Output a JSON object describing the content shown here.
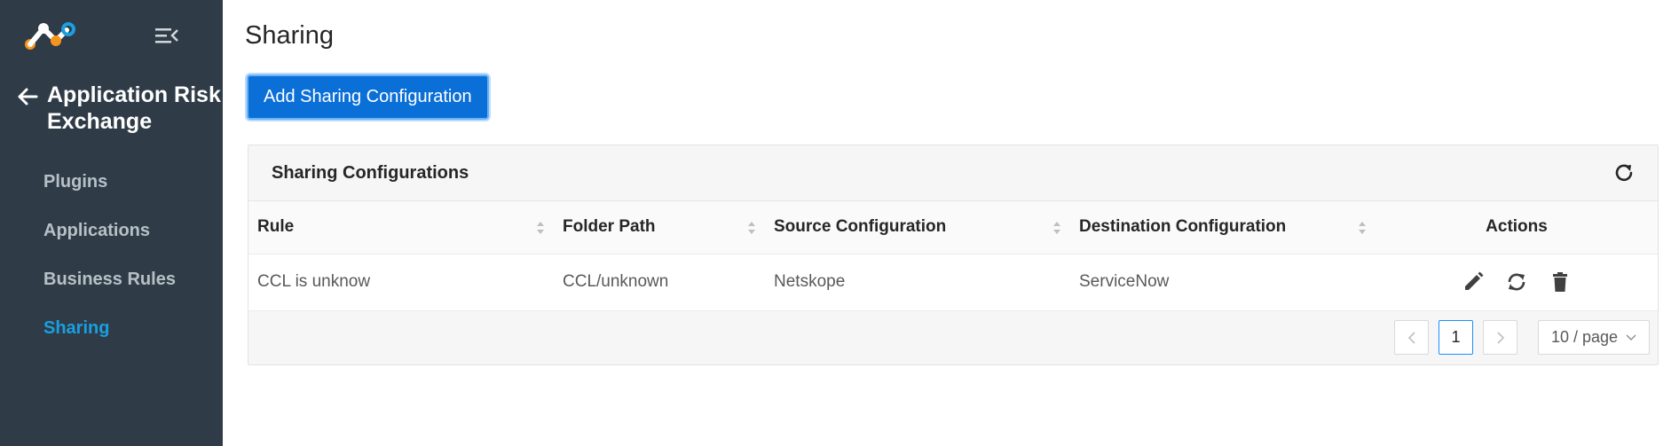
{
  "sidebar": {
    "section_title": "Application Risk Exchange",
    "items": [
      {
        "label": "Plugins",
        "active": false
      },
      {
        "label": "Applications",
        "active": false
      },
      {
        "label": "Business Rules",
        "active": false
      },
      {
        "label": "Sharing",
        "active": true
      }
    ]
  },
  "main": {
    "title": "Sharing",
    "add_button_label": "Add Sharing Configuration",
    "card": {
      "title": "Sharing Configurations",
      "columns": [
        "Rule",
        "Folder Path",
        "Source Configuration",
        "Destination Configuration",
        "Actions"
      ],
      "rows": [
        {
          "rule": "CCL is unknow",
          "folder_path": "CCL/unknown",
          "source": "Netskope",
          "destination": "ServiceNow"
        }
      ]
    },
    "pagination": {
      "current_page": "1",
      "page_size_label": "10 / page"
    }
  },
  "colors": {
    "sidebar_bg": "#2f3c47",
    "active_nav": "#1a9fe0",
    "primary_button": "#0b6fd8",
    "logo_orange": "#f7941d",
    "logo_blue": "#1a9fe0"
  }
}
